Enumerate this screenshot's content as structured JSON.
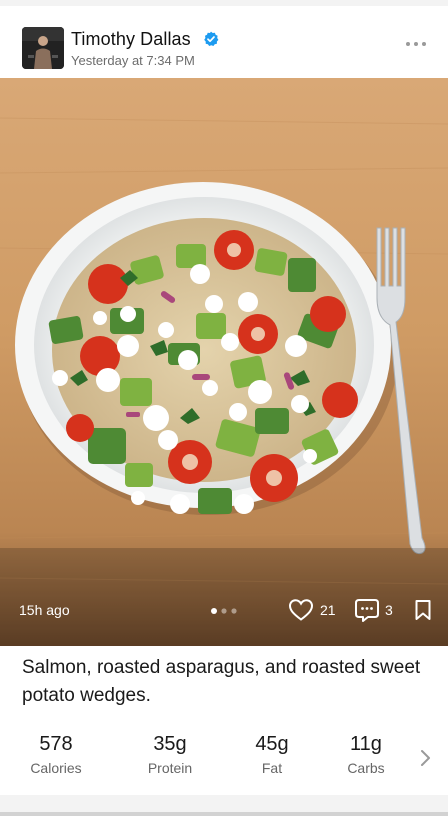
{
  "post": {
    "author_name": "Timothy Dallas",
    "timestamp": "Yesterday at 7:34 PM",
    "relative_time": "15h ago",
    "likes": "21",
    "comments": "3",
    "caption": "Salmon, roasted asparagus, and roasted sweet potato wedges."
  },
  "carousel": {
    "total": 3,
    "active": 1
  },
  "macros": [
    {
      "value": "578",
      "label": "Calories"
    },
    {
      "value": "35g",
      "label": "Protein"
    },
    {
      "value": "45g",
      "label": "Fat"
    },
    {
      "value": "11g",
      "label": "Carbs"
    }
  ],
  "icons": [
    "verified-badge-icon",
    "more-icon",
    "heart-icon",
    "comment-icon",
    "bookmark-icon",
    "chevron-right-icon"
  ],
  "colors": {
    "verified": "#1d9bf0",
    "text_secondary": "#6c6c6c"
  }
}
